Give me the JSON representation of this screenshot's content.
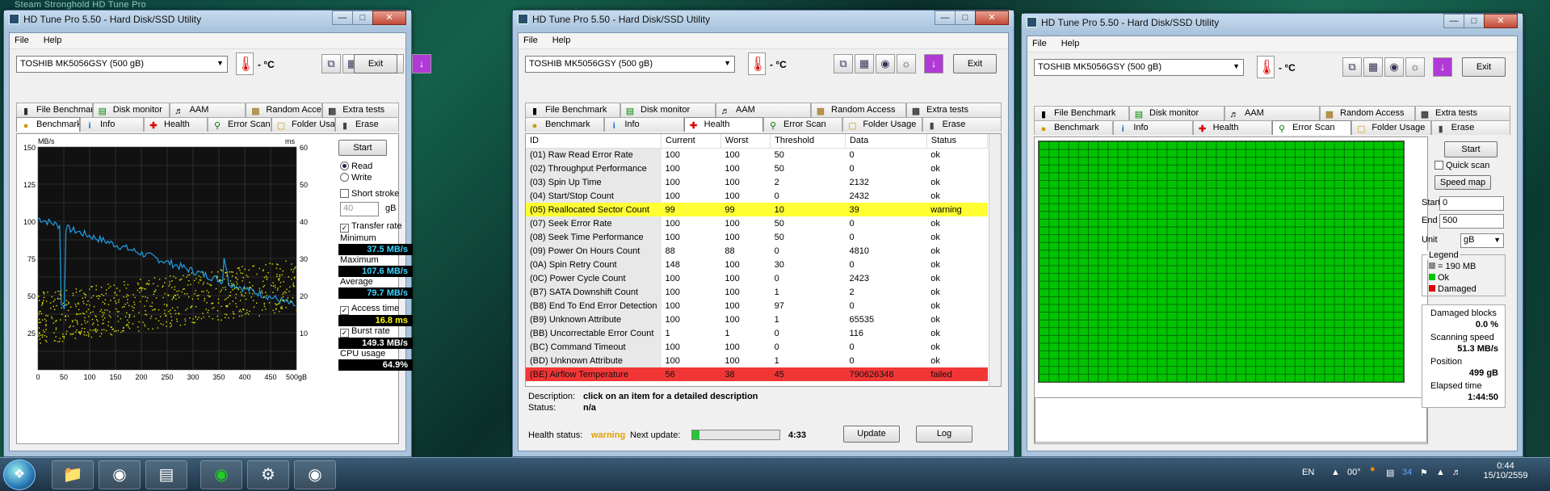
{
  "desktop": {
    "top_text": "Steam          Stronghold    HD Tune Pro"
  },
  "window": {
    "title": "HD Tune Pro 5.50 - Hard Disk/SSD Utility",
    "menu": [
      "File",
      "Help"
    ],
    "drive": "TOSHIB MK5056GSY (500 gB)",
    "temp": "- °C",
    "exit": "Exit",
    "tabs_top": [
      "File Benchmark",
      "Disk monitor",
      "AAM",
      "Random Access",
      "Extra tests"
    ],
    "tabs_bottom": [
      "Benchmark",
      "Info",
      "Health",
      "Error Scan",
      "Folder Usage",
      "Erase"
    ]
  },
  "benchmark": {
    "y_left_unit": "MB/s",
    "y_right_unit": "ms",
    "y_left_ticks": [
      "150",
      "125",
      "100",
      "75",
      "50",
      "25"
    ],
    "y_right_ticks": [
      "60",
      "50",
      "40",
      "30",
      "20",
      "10"
    ],
    "x_ticks": [
      "0",
      "50",
      "100",
      "150",
      "200",
      "250",
      "300",
      "350",
      "400",
      "450",
      "500gB"
    ],
    "start": "Start",
    "read": "Read",
    "write": "Write",
    "short_stroke": "Short stroke",
    "stroke_value": "40",
    "stroke_unit": "gB",
    "transfer_rate": "Transfer rate",
    "minimum_label": "Minimum",
    "minimum": "37.5 MB/s",
    "maximum_label": "Maximum",
    "maximum": "107.6 MB/s",
    "average_label": "Average",
    "average": "79.7 MB/s",
    "access_time_label": "Access time",
    "access_time": "16.8 ms",
    "burst_rate_label": "Burst rate",
    "burst_rate": "149.3 MB/s",
    "cpu_label": "CPU usage",
    "cpu": "64.9%",
    "colors": {
      "transfer": "#1fa0e6",
      "access": "#e6e600"
    }
  },
  "health": {
    "columns": [
      "ID",
      "Current",
      "Worst",
      "Threshold",
      "Data",
      "Status"
    ],
    "rows": [
      [
        "(01) Raw Read Error Rate",
        "100",
        "100",
        "50",
        "0",
        "ok"
      ],
      [
        "(02) Throughput Performance",
        "100",
        "100",
        "50",
        "0",
        "ok"
      ],
      [
        "(03) Spin Up Time",
        "100",
        "100",
        "2",
        "2132",
        "ok"
      ],
      [
        "(04) Start/Stop Count",
        "100",
        "100",
        "0",
        "2432",
        "ok"
      ],
      [
        "(05) Reallocated Sector Count",
        "99",
        "99",
        "10",
        "39",
        "warning"
      ],
      [
        "(07) Seek Error Rate",
        "100",
        "100",
        "50",
        "0",
        "ok"
      ],
      [
        "(08) Seek Time Performance",
        "100",
        "100",
        "50",
        "0",
        "ok"
      ],
      [
        "(09) Power On Hours Count",
        "88",
        "88",
        "0",
        "4810",
        "ok"
      ],
      [
        "(0A) Spin Retry Count",
        "148",
        "100",
        "30",
        "0",
        "ok"
      ],
      [
        "(0C) Power Cycle Count",
        "100",
        "100",
        "0",
        "2423",
        "ok"
      ],
      [
        "(B7) SATA Downshift Count",
        "100",
        "100",
        "1",
        "2",
        "ok"
      ],
      [
        "(B8) End To End Error Detection",
        "100",
        "100",
        "97",
        "0",
        "ok"
      ],
      [
        "(B9) Unknown Attribute",
        "100",
        "100",
        "1",
        "65535",
        "ok"
      ],
      [
        "(BB) Uncorrectable Error Count",
        "1",
        "1",
        "0",
        "116",
        "ok"
      ],
      [
        "(BC) Command Timeout",
        "100",
        "100",
        "0",
        "0",
        "ok"
      ],
      [
        "(BD) Unknown Attribute",
        "100",
        "100",
        "1",
        "0",
        "ok"
      ],
      [
        "(BE) Airflow Temperature",
        "56",
        "38",
        "45",
        "790626348",
        "failed"
      ]
    ],
    "description_label": "Description:",
    "description": "click on an item for a detailed description",
    "status_label": "Status:",
    "status": "n/a",
    "health_status_label": "Health status:",
    "health_status": "warning",
    "next_update_label": "Next update:",
    "next_update": "4:33",
    "update_progress": 0.08,
    "update": "Update",
    "log": "Log"
  },
  "errorscan": {
    "start": "Start",
    "quick_scan": "Quick scan",
    "speed_map": "Speed map",
    "start_label": "Start",
    "start_value": "0",
    "end_label": "End",
    "end_value": "500",
    "unit_label": "Unit",
    "unit_value": "gB",
    "legend_title": "Legend",
    "legend_block": "= 190 MB",
    "legend_ok": "Ok",
    "legend_damaged": "Damaged",
    "damaged_blocks_label": "Damaged blocks",
    "damaged_blocks": "0.0 %",
    "scanning_speed_label": "Scanning speed",
    "scanning_speed": "51.3 MB/s",
    "position_label": "Position",
    "position": "499 gB",
    "elapsed_label": "Elapsed time",
    "elapsed": "1:44:50",
    "colors": {
      "ok": "#00c400",
      "damaged": "#e00000"
    }
  },
  "taskbar": {
    "lang": "EN",
    "time": "0:44",
    "date": "15/10/2559",
    "tray_temp": "00°",
    "tray_num": "34"
  }
}
